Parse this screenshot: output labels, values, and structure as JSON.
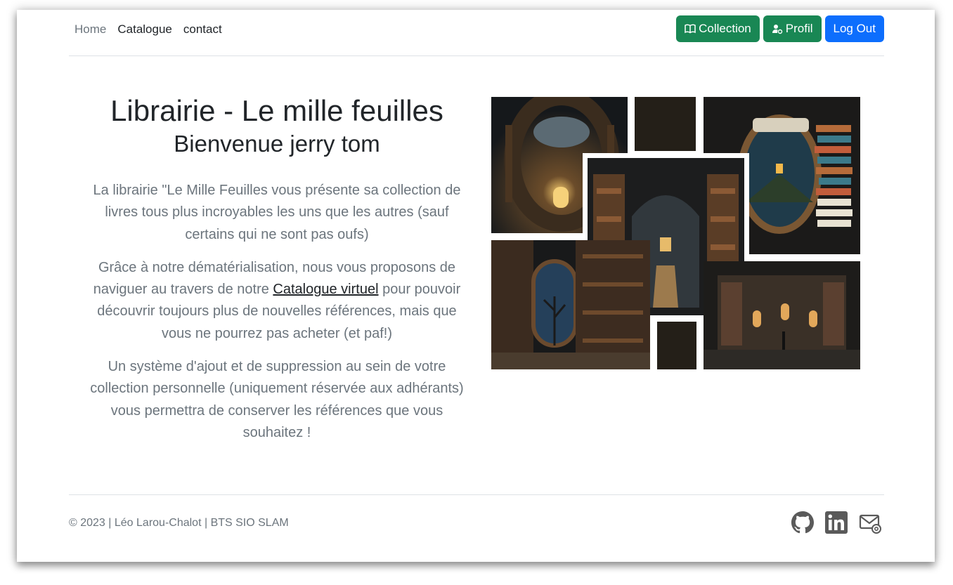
{
  "nav": {
    "links": [
      {
        "label": "Home"
      },
      {
        "label": "Catalogue"
      },
      {
        "label": "contact"
      }
    ],
    "buttons": {
      "collection": {
        "label": "Collection",
        "icon": "book-icon",
        "color": "#198754"
      },
      "profil": {
        "label": "Profil",
        "icon": "person-gear-icon",
        "color": "#198754"
      },
      "logout": {
        "label": "Log Out",
        "color": "#0d6efd"
      }
    }
  },
  "hero": {
    "title": "Librairie - Le mille feuilles",
    "subtitle": "Bienvenue jerry tom",
    "paragraph1": "La librairie \"Le Mille Feuilles vous présente sa collection de livres tous plus incroyables les uns que les autres (sauf certains qui ne sont pas oufs)",
    "paragraph2_before": "Grâce à notre dématérialisation, nous vous proposons de naviguer au travers de notre ",
    "paragraph2_link": "Catalogue virtuel",
    "paragraph2_after": " pour pouvoir découvrir toujours plus de nouvelles références, mais que vous ne pourrez pas acheter (et paf!)",
    "paragraph3": "Un système d'ajout et de suppression au sein de votre collection personnelle (uniquement réservée aux adhérants) vous permettra de conserver les références que vous souhaitez !"
  },
  "collage": {
    "tiles": [
      "library-arch-image",
      "dark-panel",
      "book-portal-image",
      "library-corridor-image",
      "library-window-image",
      "dark-panel",
      "library-hall-image"
    ]
  },
  "footer": {
    "copyright": "© 2023 | Léo Larou-Chalot | BTS SIO SLAM",
    "icons": [
      "github-icon",
      "linkedin-icon",
      "mail-icon"
    ]
  }
}
